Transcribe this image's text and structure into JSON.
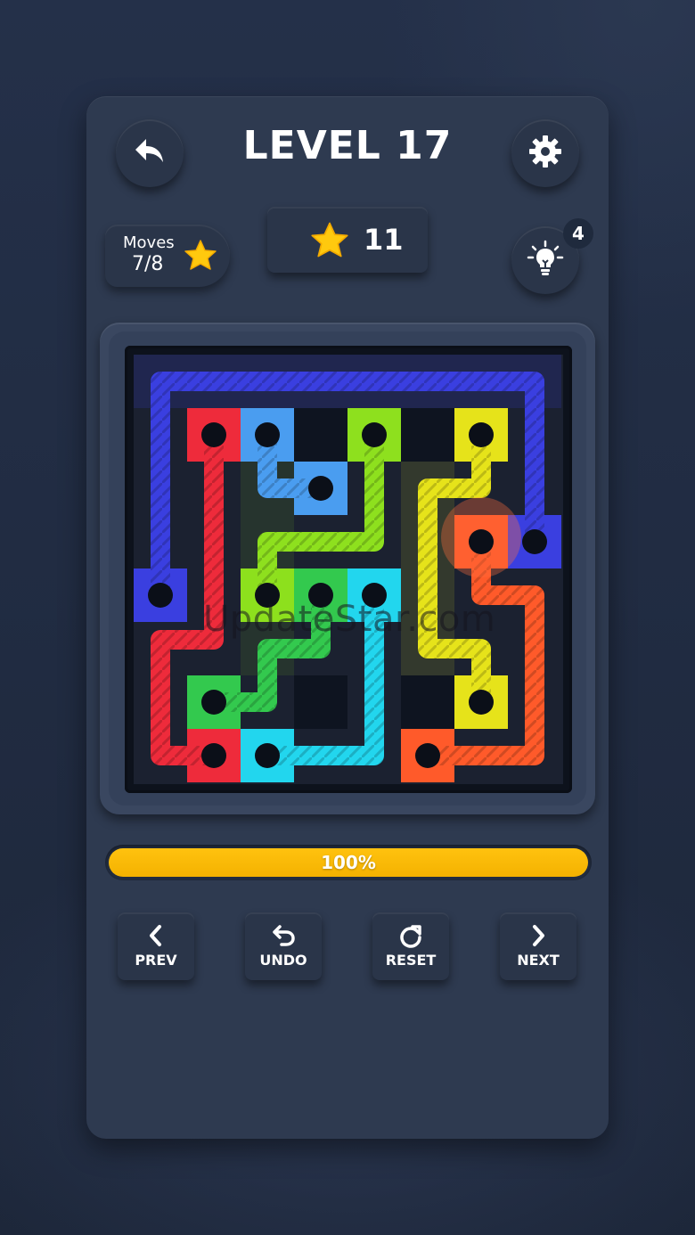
{
  "header": {
    "title": "LEVEL 17",
    "back_icon": "back-arrow-icon",
    "settings_icon": "gear-icon"
  },
  "stats": {
    "moves_label": "Moves",
    "moves_value": "7/8",
    "stars_value": "11",
    "hint_count": "4",
    "hint_icon": "lightbulb-icon",
    "star_color": "#ffc90e"
  },
  "board": {
    "grid_size": 8,
    "colors": {
      "blue": "#3a3fe0",
      "red": "#ee2b3b",
      "lightblue": "#4a9df0",
      "green": "#8ee01e",
      "darkgreen": "#33c94e",
      "cyan": "#22d6ee",
      "yellow": "#e6e31a",
      "orange": "#ff5a2a"
    }
  },
  "watermark": "UpdateStar.com",
  "progress": {
    "percent": 100,
    "label": "100%"
  },
  "controls": [
    {
      "label": "PREV",
      "icon": "chevron-left-icon"
    },
    {
      "label": "UNDO",
      "icon": "undo-icon"
    },
    {
      "label": "RESET",
      "icon": "reset-icon"
    },
    {
      "label": "NEXT",
      "icon": "chevron-right-icon"
    }
  ]
}
